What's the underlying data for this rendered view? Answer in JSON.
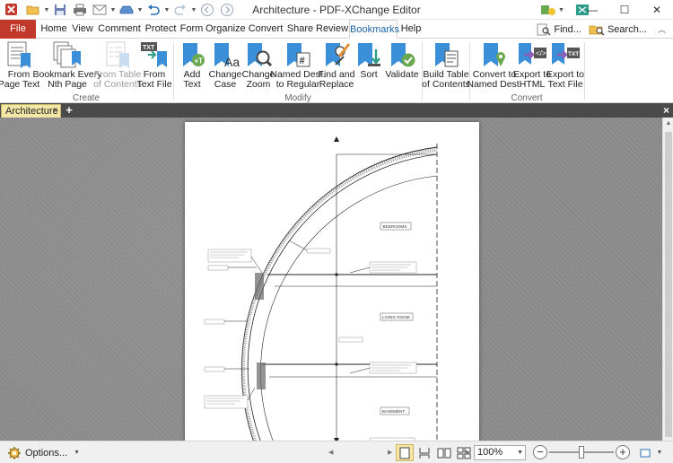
{
  "window": {
    "title": "Architecture - PDF-XChange Editor",
    "controls": {
      "minimize": "—",
      "maximize": "☐",
      "close": "✕"
    }
  },
  "ribbon_tabs": [
    {
      "label": "File"
    },
    {
      "label": "Home"
    },
    {
      "label": "View"
    },
    {
      "label": "Comment"
    },
    {
      "label": "Protect"
    },
    {
      "label": "Form"
    },
    {
      "label": "Organize"
    },
    {
      "label": "Convert"
    },
    {
      "label": "Share"
    },
    {
      "label": "Review"
    },
    {
      "label": "Bookmarks"
    },
    {
      "label": "Help"
    }
  ],
  "active_tab": "Bookmarks",
  "find": {
    "find_label": "Find...",
    "search_label": "Search..."
  },
  "ribbon": {
    "create": {
      "group_label": "Create",
      "buttons": [
        {
          "line1": "From",
          "line2": "Page Text",
          "icon": "bookmark-from-text-icon"
        },
        {
          "line1": "Bookmark Every",
          "line2": "Nth Page",
          "icon": "bookmark-nth-page-icon"
        },
        {
          "line1": "From Table",
          "line2": "of Contents",
          "icon": "bookmark-from-toc-icon",
          "disabled": true
        },
        {
          "line1": "From",
          "line2": "Text File",
          "icon": "bookmark-from-txt-file-icon"
        }
      ]
    },
    "modify": {
      "group_label": "Modify",
      "buttons": [
        {
          "line1": "Add",
          "line2": "Text",
          "icon": "add-text-icon"
        },
        {
          "line1": "Change",
          "line2": "Case",
          "icon": "change-case-icon"
        },
        {
          "line1": "Change",
          "line2": "Zoom",
          "icon": "change-zoom-icon"
        },
        {
          "line1": "Named Dest.",
          "line2": "to Regular",
          "icon": "named-dest-to-regular-icon"
        },
        {
          "line1": "Find and",
          "line2": "Replace",
          "icon": "find-replace-icon"
        },
        {
          "line1": "Sort",
          "line2": "",
          "icon": "sort-icon"
        },
        {
          "line1": "Validate",
          "line2": "",
          "icon": "validate-icon"
        }
      ]
    },
    "toc": {
      "buttons": [
        {
          "line1": "Build Table",
          "line2": "of Contents",
          "icon": "build-toc-icon"
        }
      ]
    },
    "convert": {
      "group_label": "Convert",
      "buttons": [
        {
          "line1": "Convert to",
          "line2": "Named Dest.",
          "icon": "convert-named-dest-icon"
        },
        {
          "line1": "Export to",
          "line2": "HTML",
          "icon": "export-html-icon"
        },
        {
          "line1": "Export to",
          "line2": "Text File",
          "icon": "export-text-icon"
        }
      ]
    }
  },
  "document_tabs": [
    {
      "label": "Architecture",
      "close": "×"
    }
  ],
  "new_tab_label": "+",
  "close_doc_label": "×",
  "drawing": {
    "rooms": [
      "BEDROOMS",
      "LIVING ROOM",
      "BASEMENT"
    ]
  },
  "statusbar": {
    "options_label": "Options...",
    "zoom_value": "100%",
    "zoom_level": 1.0
  },
  "colors": {
    "file_tab": "#c0392b",
    "active_tab_text": "#1a62a8",
    "document_tab": "#f3e7a8",
    "workspace": "#8c8c8c",
    "icon_blue": "#3b8fd9"
  }
}
